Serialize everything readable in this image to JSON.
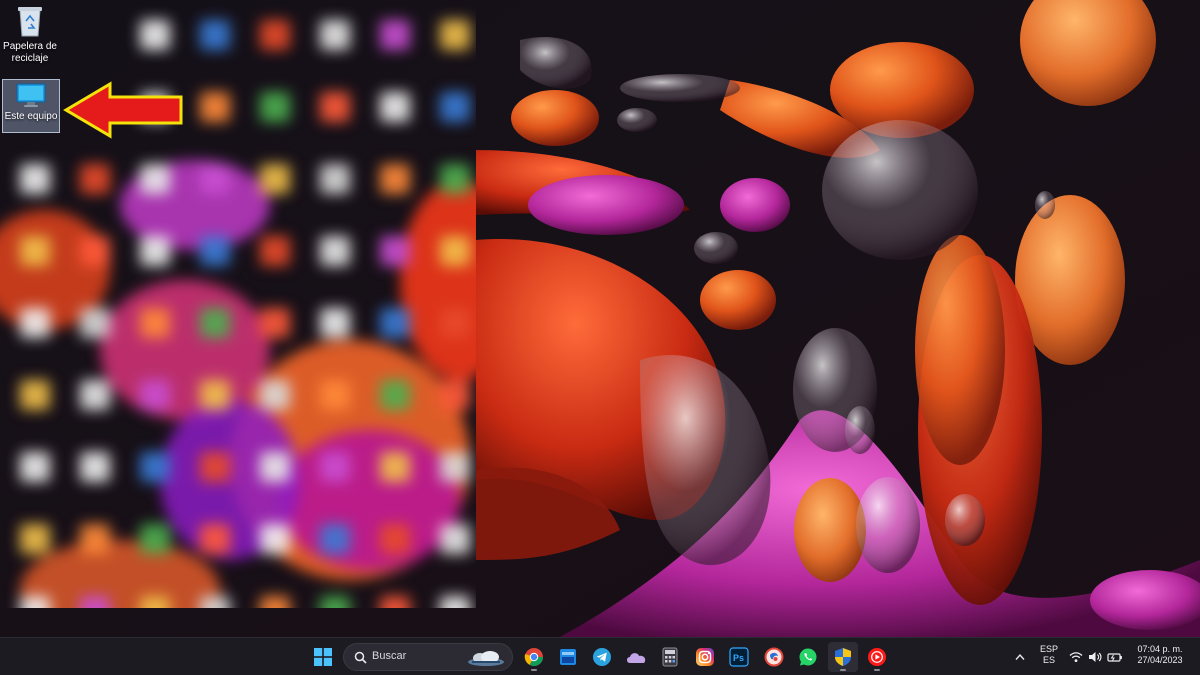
{
  "desktop": {
    "icons": [
      {
        "name": "recycle-bin",
        "label": "Papelera de reciclaje"
      },
      {
        "name": "this-pc",
        "label": "Este equipo"
      }
    ]
  },
  "taskbar": {
    "search": {
      "placeholder": "Buscar"
    },
    "apps": [
      "windows-start-icon",
      "chrome-icon",
      "app-window-icon",
      "telegram-icon",
      "onedrive-icon",
      "calculator-icon",
      "instagram-icon",
      "photoshop-icon",
      "browser-icon",
      "whatsapp-icon",
      "shield-icon",
      "youtube-music-icon"
    ],
    "tray": {
      "language_top": "ESP",
      "language_bottom": "ES",
      "time": "07:04 p. m.",
      "date": "27/04/2023"
    }
  },
  "colors": {
    "taskbar_bg": "#1c1b22",
    "arrow_fill": "#e51b1b",
    "arrow_stroke": "#f4e30a",
    "selection": "#9aaac8"
  }
}
